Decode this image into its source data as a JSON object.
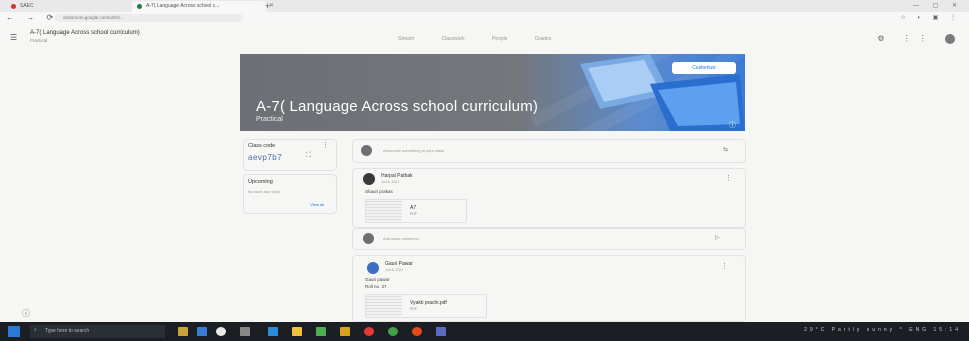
{
  "browser": {
    "tabs": [
      {
        "label": "SAEC",
        "icon": "saec-tab-icon",
        "color": "#d93025"
      },
      {
        "label": "A-7( Language Across school c...",
        "icon": "classroom-tab-icon",
        "color": "#188038"
      }
    ],
    "new_tab_icon": "plus-icon",
    "url": "classroom.google.com/u/0/c/..."
  },
  "header": {
    "class_title": "A-7( Language Across school curriculum)",
    "class_subtitle": "Practical",
    "nav": [
      "Stream",
      "Classwork",
      "People",
      "Grades"
    ]
  },
  "banner": {
    "title": "A-7( Language Across school curriculum)",
    "subtitle": "Practical",
    "customize_label": "Customize"
  },
  "class_code": {
    "label": "Class code",
    "code": "aevp7b7"
  },
  "upcoming": {
    "label": "Upcoming",
    "text": "No work due soon",
    "link": "View all"
  },
  "announce": {
    "placeholder": "Announce something to your class"
  },
  "posts": [
    {
      "author": "Harpal Pathak",
      "date": "Jun 8, 2021",
      "text": "Shauri prakas",
      "attachment": {
        "name": "A7",
        "type": "PDF"
      }
    },
    {
      "comment_placeholder": "Add class comment..."
    },
    {
      "author": "Gauri Pawar",
      "date": "Jun 8, 2021",
      "text": "Gauri pawar",
      "text2": "Roll no. 37",
      "attachment": {
        "name": "Vyakti prachi.pdf",
        "type": "PDF"
      }
    }
  ],
  "taskbar": {
    "search_placeholder": "Type here to search",
    "tray_text": "29°C Partly sunny  ^  ENG  15:14"
  },
  "colors": {
    "accent": "#1a73e8",
    "banner_gray": "#6c6f74",
    "banner_blue": "#3c7bd6",
    "taskbar": "#1b1f24"
  }
}
